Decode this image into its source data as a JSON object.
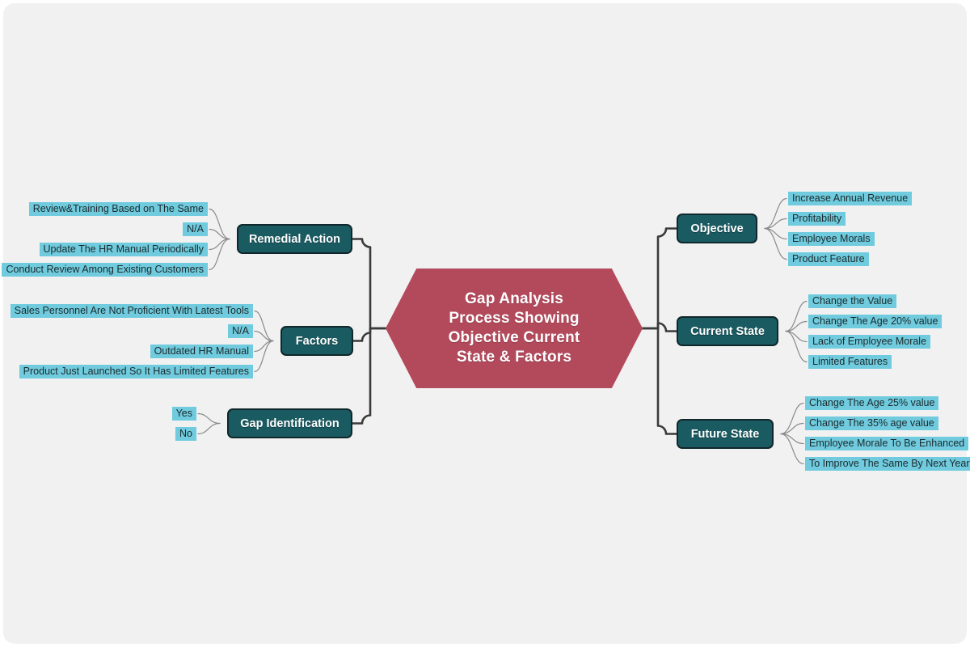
{
  "diagram": {
    "type": "mind-map",
    "center": {
      "label": "Gap Analysis Process Showing Objective Current State & Factors",
      "lines": [
        "Gap Analysis",
        "Process Showing",
        "Objective Current",
        "State & Factors"
      ],
      "shape": "hexagon",
      "color": "#b34a5c",
      "text_color": "#ffffff"
    },
    "colors": {
      "background": "#f1f1f1",
      "page": "#ffffff",
      "branch_fill": "#1a5b62",
      "branch_border": "#10272b",
      "branch_text": "#ffffff",
      "leaf_fill": "#6fcbdd",
      "leaf_text": "#1d2a2e",
      "trunk_line": "#3a3a3a",
      "twig_line": "#8a8a8a"
    },
    "left_branches": [
      {
        "label": "Remedial Action",
        "leaves": [
          "Review&Training Based on The Same",
          "N/A",
          "Update The HR Manual Periodically",
          "Conduct Review Among Existing Customers"
        ]
      },
      {
        "label": "Factors",
        "leaves": [
          "Sales Personnel Are Not Proficient With Latest Tools",
          "N/A",
          "Outdated HR Manual",
          "Product Just Launched So It Has Limited Features"
        ]
      },
      {
        "label": "Gap Identification",
        "leaves": [
          "Yes",
          "No"
        ]
      }
    ],
    "right_branches": [
      {
        "label": "Objective",
        "leaves": [
          "Increase Annual Revenue",
          "Profitability",
          "Employee Morals",
          "Product Feature"
        ]
      },
      {
        "label": "Current State",
        "leaves": [
          "Change the Value",
          "Change The Age 20% value",
          "Lack of Employee Morale",
          "Limited Features"
        ]
      },
      {
        "label": "Future State",
        "leaves": [
          "Change The Age 25% value",
          "Change The 35% age value",
          "Employee Morale To Be Enhanced",
          "To Improve The Same By Next Year"
        ]
      }
    ]
  }
}
